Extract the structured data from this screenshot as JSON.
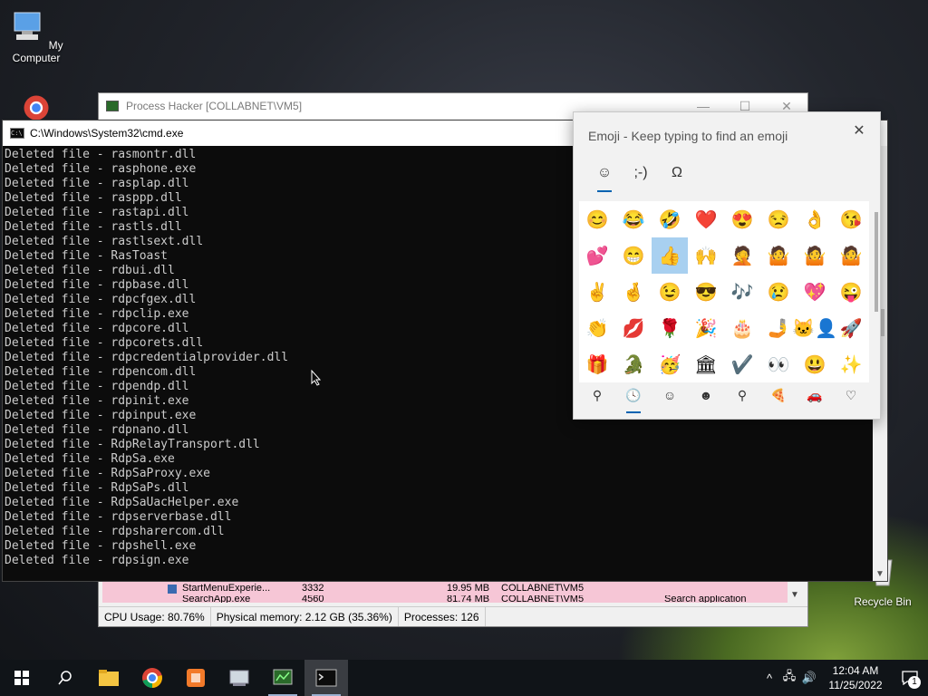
{
  "desktop": {
    "icons": [
      {
        "label": "My Computer",
        "icon": "computer-icon"
      },
      {
        "label": "Recycle Bin",
        "icon": "recycle-bin-icon"
      }
    ]
  },
  "process_hacker": {
    "title": "Process Hacker [COLLABNET\\VM5]",
    "controls": {
      "minimize": "—",
      "maximize": "☐",
      "close": "✕"
    },
    "rows": [
      {
        "name": "StartMenuExperie...",
        "pid": "3332",
        "memory": "19.95 MB",
        "user": "COLLABNET\\VM5",
        "desc": ""
      },
      {
        "name": "SearchApp.exe",
        "pid": "4560",
        "memory": "81.74 MB",
        "user": "COLLABNET\\VM5",
        "desc": "Search application"
      }
    ],
    "status": {
      "cpu": "CPU Usage: 80.76%",
      "memory": "Physical memory: 2.12 GB (35.36%)",
      "processes": "Processes: 126"
    }
  },
  "cmd": {
    "title": "C:\\Windows\\System32\\cmd.exe",
    "lines": [
      "Deleted file - rasmontr.dll",
      "Deleted file - rasphone.exe",
      "Deleted file - rasplap.dll",
      "Deleted file - rasppp.dll",
      "Deleted file - rastapi.dll",
      "Deleted file - rastls.dll",
      "Deleted file - rastlsext.dll",
      "Deleted file - RasToast",
      "Deleted file - rdbui.dll",
      "Deleted file - rdpbase.dll",
      "Deleted file - rdpcfgex.dll",
      "Deleted file - rdpclip.exe",
      "Deleted file - rdpcore.dll",
      "Deleted file - rdpcorets.dll",
      "Deleted file - rdpcredentialprovider.dll",
      "Deleted file - rdpencom.dll",
      "Deleted file - rdpendp.dll",
      "Deleted file - rdpinit.exe",
      "Deleted file - rdpinput.exe",
      "Deleted file - rdpnano.dll",
      "Deleted file - RdpRelayTransport.dll",
      "Deleted file - RdpSa.exe",
      "Deleted file - RdpSaProxy.exe",
      "Deleted file - RdpSaPs.dll",
      "Deleted file - RdpSaUacHelper.exe",
      "Deleted file - rdpserverbase.dll",
      "Deleted file - rdpsharercom.dll",
      "Deleted file - rdpshell.exe",
      "Deleted file - rdpsign.exe"
    ]
  },
  "emoji_panel": {
    "title": "Emoji - Keep typing to find an emoji",
    "close": "✕",
    "tabs": [
      {
        "glyph": "☺",
        "icon": "emoji-tab-icon"
      },
      {
        "glyph": ";-)",
        "icon": "kaomoji-tab-icon"
      },
      {
        "glyph": "Ω",
        "icon": "symbols-tab-icon"
      }
    ],
    "emojis": [
      [
        "😊",
        "😂",
        "🤣",
        "❤️",
        "😍",
        "😒",
        "👌",
        "😘"
      ],
      [
        "💕",
        "😁",
        "👍",
        "🙌",
        "🤦",
        "🤷",
        "🤷",
        "🤷"
      ],
      [
        "✌️",
        "🤞",
        "😉",
        "😎",
        "🎶",
        "😢",
        "💖",
        "😜"
      ],
      [
        "👏",
        "💋",
        "🌹",
        "🎉",
        "🎂",
        "🤳",
        "🐱‍👤",
        "🚀"
      ],
      [
        "🎁",
        "🐊",
        "🥳",
        "🏛",
        "✔️",
        "👀",
        "😃",
        "✨"
      ]
    ],
    "categories": [
      {
        "glyph": "⚲",
        "icon": "search-icon"
      },
      {
        "glyph": "🕓",
        "icon": "recent-icon"
      },
      {
        "glyph": "☺",
        "icon": "smiley-icon"
      },
      {
        "glyph": "☻",
        "icon": "people-icon"
      },
      {
        "glyph": "⚲",
        "icon": "celebration-icon"
      },
      {
        "glyph": "🍕",
        "icon": "food-icon"
      },
      {
        "glyph": "🚗",
        "icon": "travel-icon"
      },
      {
        "glyph": "♡",
        "icon": "heart-icon"
      }
    ]
  },
  "taskbar": {
    "apps": [
      {
        "icon": "start-icon"
      },
      {
        "icon": "search-icon"
      },
      {
        "icon": "file-explorer-icon"
      },
      {
        "icon": "chrome-icon"
      },
      {
        "icon": "app-orange-icon"
      },
      {
        "icon": "network-tool-icon"
      },
      {
        "icon": "process-hacker-icon"
      },
      {
        "icon": "cmd-icon"
      }
    ],
    "tray": {
      "chevron": "^",
      "network": "🖧",
      "volume": "🔊"
    },
    "time": "12:04 AM",
    "date": "11/25/2022",
    "notification_count": "1"
  }
}
